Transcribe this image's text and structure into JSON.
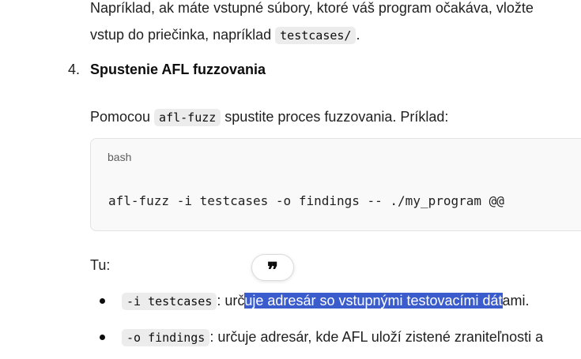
{
  "intro": {
    "line1": "Napríklad, ak máte vstupné súbory, ktoré váš program očakáva, vložte",
    "line2_prefix": "vstup do priečinka, napríklad ",
    "line2_code": "testcases/",
    "line2_suffix": "."
  },
  "step4": {
    "number": "4.",
    "heading": "Spustenie AFL fuzzovania",
    "para_prefix": "Pomocou ",
    "para_code": "afl-fuzz",
    "para_suffix": " spustite proces fuzzovania. Príklad:"
  },
  "code_block": {
    "language": "bash",
    "code": "afl-fuzz -i testcases -o findings -- ./my_program @@"
  },
  "explain": {
    "label": "Tu:",
    "quote_button": "❞",
    "items": [
      {
        "code": "-i testcases",
        "text_before": ": urč",
        "text_selected": "uje adresár so vstupnými testovacími dát",
        "text_after": "ami."
      },
      {
        "code": "-o findings",
        "text": ": určuje adresár, kde AFL uloží zistené zraniteľnosti a"
      }
    ]
  },
  "colors": {
    "selection": "#3b5ccc",
    "code_bg": "#ececec",
    "block_bg": "#f9f9f9"
  }
}
